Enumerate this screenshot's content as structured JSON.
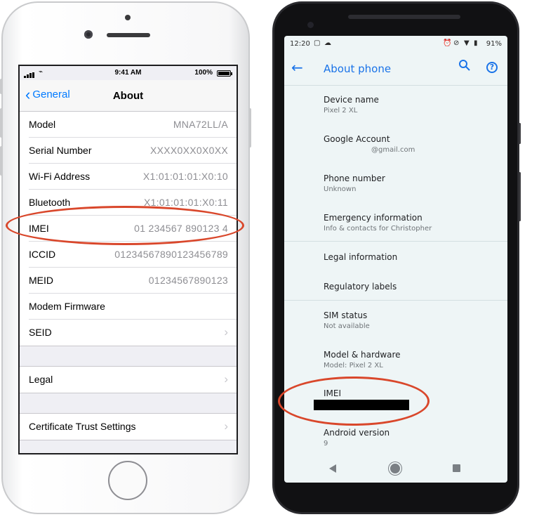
{
  "iphone": {
    "status": {
      "time": "9:41 AM",
      "battery": "100%",
      "battery_level": 1.0
    },
    "nav": {
      "back_label": "General",
      "title": "About"
    },
    "rows": [
      {
        "label": "Model",
        "value": "MNA72LL/A"
      },
      {
        "label": "Serial Number",
        "value": "XXXX0XX0X0XX"
      },
      {
        "label": "Wi-Fi Address",
        "value": "X1:01:01:01:X0:10"
      },
      {
        "label": "Bluetooth",
        "value": "X1:01:01:01:X0:11"
      },
      {
        "label": "IMEI",
        "value": "01 234567 890123 4"
      },
      {
        "label": "ICCID",
        "value": "01234567890123456789"
      },
      {
        "label": "MEID",
        "value": "01234567890123"
      },
      {
        "label": "Modem Firmware",
        "value": ""
      },
      {
        "label": "SEID",
        "value": ""
      }
    ],
    "legal": {
      "label": "Legal"
    },
    "cert": {
      "label": "Certificate Trust Settings"
    }
  },
  "android": {
    "status": {
      "time": "12:20",
      "battery": "91%"
    },
    "appbar": {
      "title": "About phone"
    },
    "items": [
      {
        "primary": "Device name",
        "secondary": "Pixel 2 XL"
      },
      {
        "primary": "Google Account",
        "secondary": "@gmail.com"
      },
      {
        "primary": "Phone number",
        "secondary": "Unknown"
      },
      {
        "primary": "Emergency information",
        "secondary": "Info & contacts for Christopher"
      },
      {
        "primary": "Legal information",
        "secondary": ""
      },
      {
        "primary": "Regulatory labels",
        "secondary": ""
      },
      {
        "primary": "SIM status",
        "secondary": "Not available"
      },
      {
        "primary": "Model & hardware",
        "secondary": "Model: Pixel 2 XL"
      },
      {
        "primary": "IMEI",
        "secondary": ""
      },
      {
        "primary": "Android version",
        "secondary": "9"
      }
    ]
  },
  "colors": {
    "ios_blue": "#007aff",
    "android_blue": "#1a73e8",
    "annotation_red": "#d9472b"
  },
  "icons": [
    "back-chevron-icon",
    "disclosure-chevron-icon",
    "back-arrow-icon",
    "search-icon",
    "help-icon",
    "wifi-icon",
    "battery-icon",
    "nav-back-icon",
    "nav-home-icon",
    "nav-recents-icon"
  ]
}
